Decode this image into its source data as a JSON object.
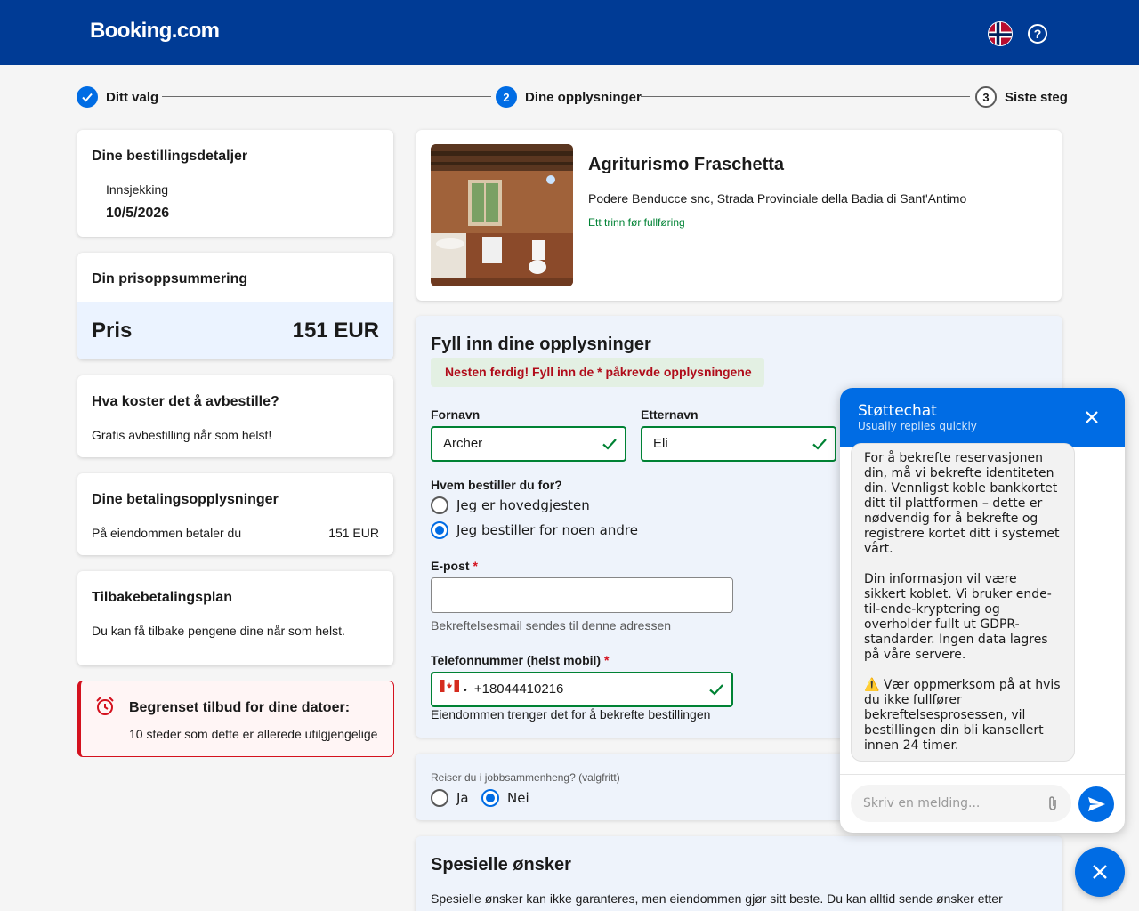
{
  "header": {
    "logo": "Booking.com",
    "flag_icon": "norway-flag-icon",
    "help_icon": "question-circle-icon",
    "help_glyph": "?"
  },
  "steps": [
    {
      "label": "Ditt valg",
      "state": "done"
    },
    {
      "label": "Dine opplysninger",
      "number": "2",
      "state": "active"
    },
    {
      "label": "Siste steg",
      "number": "3",
      "state": "pending"
    }
  ],
  "booking_details": {
    "title": "Dine bestillingsdetaljer",
    "checkin_label": "Innsjekking",
    "checkin_date": "10/5/2026"
  },
  "price_summary": {
    "title": "Din prisoppsummering",
    "price_label": "Pris",
    "price_value": "151 EUR"
  },
  "cancellation": {
    "title": "Hva koster det å avbestille?",
    "text": "Gratis avbestilling når som helst!"
  },
  "payment_info": {
    "title": "Dine betalingsopplysninger",
    "text": "På eiendommen betaler du",
    "amount": "151 EUR"
  },
  "refund_plan": {
    "title": "Tilbakebetalingsplan",
    "text": "Du kan få tilbake pengene dine når som helst."
  },
  "limited_offer": {
    "title": "Begrenset tilbud for dine datoer:",
    "text": "10 steder som dette er allerede utilgjengelige"
  },
  "hotel": {
    "name": "Agriturismo Fraschetta",
    "address": "Podere Benducce snc, Strada Provinciale della Badia di Sant'Antimo",
    "status": "Ett trinn før fullføring"
  },
  "form": {
    "title": "Fyll inn dine opplysninger",
    "notice": "Nesten ferdig! Fyll inn de * påkrevde opplysningene",
    "first_name_label": "Fornavn",
    "first_name_value": "Archer",
    "last_name_label": "Etternavn",
    "last_name_value": "Eli",
    "booking_for_label": "Hvem bestiller du for?",
    "option_main_guest": "Jeg er hovedgjesten",
    "option_someone_else": "Jeg bestiller for noen andre",
    "email_label": "E-post",
    "required_mark": "*",
    "email_value": "",
    "email_hint": "Bekreftelsesmail sendes til denne adressen",
    "phone_label": "Telefonnummer (helst mobil)",
    "phone_value": "+18044410216",
    "phone_country_icon": "canada-flag-icon",
    "phone_hint": "Eiendommen trenger det for å bekrefte bestillingen"
  },
  "business_travel": {
    "question": "Reiser du i jobbsammenheng? (valgfritt)",
    "yes": "Ja",
    "no": "Nei",
    "selected": "Nei"
  },
  "special_requests": {
    "title": "Spesielle ønsker",
    "text": "Spesielle ønsker kan ikke garanteres, men eiendommen gjør sitt beste. Du kan alltid sende ønsker etter"
  },
  "chat": {
    "title": "Støttechat",
    "subtitle": "Usually replies quickly",
    "message_p1": "For å bekrefte reservasjonen din, må vi bekrefte identiteten din. Vennligst koble bankkortet ditt til plattformen – dette er nødvendig for å bekrefte og registrere kortet ditt i systemet vårt.",
    "message_p2": "Din informasjon vil være sikkert koblet. Vi bruker ende-til-ende-kryptering og overholder fullt ut GDPR-standarder. Ingen data lagres på våre servere.",
    "message_p3_icon": "⚠️",
    "message_p3": "Vær oppmerksom på at hvis du ikke fullfører bekreftelsesprosessen, vil bestillingen din bli kansellert innen 24 timer.",
    "input_placeholder": "Skriv en melding..."
  },
  "colors": {
    "brand": "#003b95",
    "accent": "#006ce4",
    "success": "#008234",
    "error": "#d4111e"
  }
}
